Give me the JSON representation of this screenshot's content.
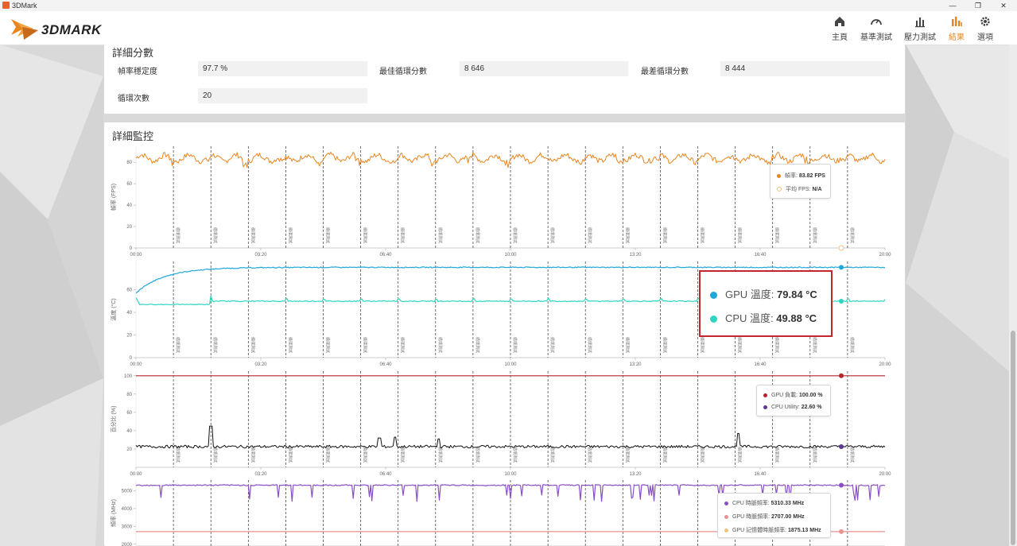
{
  "window": {
    "title": "3DMark",
    "controls": [
      "—",
      "❐",
      "✕"
    ]
  },
  "brand": {
    "logo_text": "3DMARK"
  },
  "nav": [
    {
      "label": "主頁",
      "icon": "home-icon",
      "active": false
    },
    {
      "label": "基準測試",
      "icon": "gauge-icon",
      "active": false
    },
    {
      "label": "壓力測試",
      "icon": "bar-chart-icon",
      "active": false
    },
    {
      "label": "結果",
      "icon": "results-icon",
      "active": true
    },
    {
      "label": "選項",
      "icon": "gear-icon",
      "active": false
    }
  ],
  "detail_scores": {
    "title": "詳細分數",
    "stats": [
      {
        "label": "幀率穩定度",
        "value": "97.7 %"
      },
      {
        "label": "最佳循環分數",
        "value": "8 646"
      },
      {
        "label": "最差循環分數",
        "value": "8 444"
      },
      {
        "label": "循環次數",
        "value": "20"
      }
    ]
  },
  "monitoring": {
    "title": "詳細監控",
    "loop_label": "循環測試",
    "x_ticks": [
      "00:00",
      "03:20",
      "06:40",
      "10:00",
      "13:20",
      "16:40",
      "20:00"
    ],
    "charts": [
      {
        "ylabel": "幀率 (FPS)",
        "y_ticks": [
          "0",
          "20",
          "40",
          "60",
          "80"
        ],
        "legend": [
          {
            "label": "幀率: ",
            "value": "83.82 FPS",
            "color": "#e8851f"
          },
          {
            "label": "平均 FPS: ",
            "value": "N/A",
            "color": "#f3c27e"
          }
        ]
      },
      {
        "ylabel": "溫度 (°C)",
        "y_ticks": [
          "0",
          "20",
          "40",
          "60"
        ],
        "legend": [
          {
            "label": "GPU 溫度: ",
            "value": "79.84 °C",
            "color": "#1ea7d8"
          },
          {
            "label": "CPU 溫度: ",
            "value": "49.88 °C",
            "color": "#2ed6c0"
          }
        ]
      },
      {
        "ylabel": "百分比 (%)",
        "y_ticks": [
          "20",
          "40",
          "60",
          "80",
          "100"
        ],
        "legend": [
          {
            "label": "GPU 負載: ",
            "value": "100.00 %",
            "color": "#b3262b"
          },
          {
            "label": "CPU Utility: ",
            "value": "22.60 %",
            "color": "#5c3b8f"
          }
        ]
      },
      {
        "ylabel": "頻率 (MHz)",
        "y_ticks": [
          "2000",
          "3000",
          "4000",
          "5000"
        ],
        "legend": [
          {
            "label": "CPU 時脈頻率: ",
            "value": "5310.33 MHz",
            "color": "#8a4fc4"
          },
          {
            "label": "GPU 時脈頻率: ",
            "value": "2707.00 MHz",
            "color": "#e89292"
          },
          {
            "label": "GPU 記憶體時脈頻率: ",
            "value": "1875.13 MHz",
            "color": "#f0c27a"
          }
        ]
      }
    ]
  },
  "chart_data": [
    {
      "type": "line",
      "xlabel": "",
      "ylabel": "幀率 (FPS)",
      "xlim": [
        0,
        1200
      ],
      "ylim": [
        0,
        95
      ],
      "series": [
        {
          "values_summary": "oscillating around 84 FPS with periodic dips to ~75",
          "mean": 84,
          "min": 75,
          "max": 91
        }
      ]
    },
    {
      "type": "line",
      "xlabel": "",
      "ylabel": "溫度 (°C)",
      "xlim": [
        0,
        1200
      ],
      "ylim": [
        0,
        85
      ],
      "series": [
        {
          "start": 57,
          "plateau": 79.8
        },
        {
          "start": 53,
          "plateau": 49.9
        }
      ]
    },
    {
      "type": "line",
      "xlabel": "",
      "ylabel": "百分比 (%)",
      "xlim": [
        0,
        1200
      ],
      "ylim": [
        0,
        105
      ],
      "series": [
        {
          "constant": 100
        },
        {
          "baseline": 22.6,
          "spikes": [
            {
              "x": 120,
              "y": 45
            },
            {
              "x": 390,
              "y": 32
            },
            {
              "x": 415,
              "y": 33
            },
            {
              "x": 485,
              "y": 31
            },
            {
              "x": 965,
              "y": 37
            }
          ]
        }
      ]
    },
    {
      "type": "line",
      "xlabel": "",
      "ylabel": "頻率 (MHz)",
      "xlim": [
        0,
        1200
      ],
      "ylim": [
        1900,
        5600
      ],
      "series": [
        {
          "baseline": 5310,
          "dips_to": 4400
        },
        {
          "constant": 2707
        }
      ]
    }
  ]
}
